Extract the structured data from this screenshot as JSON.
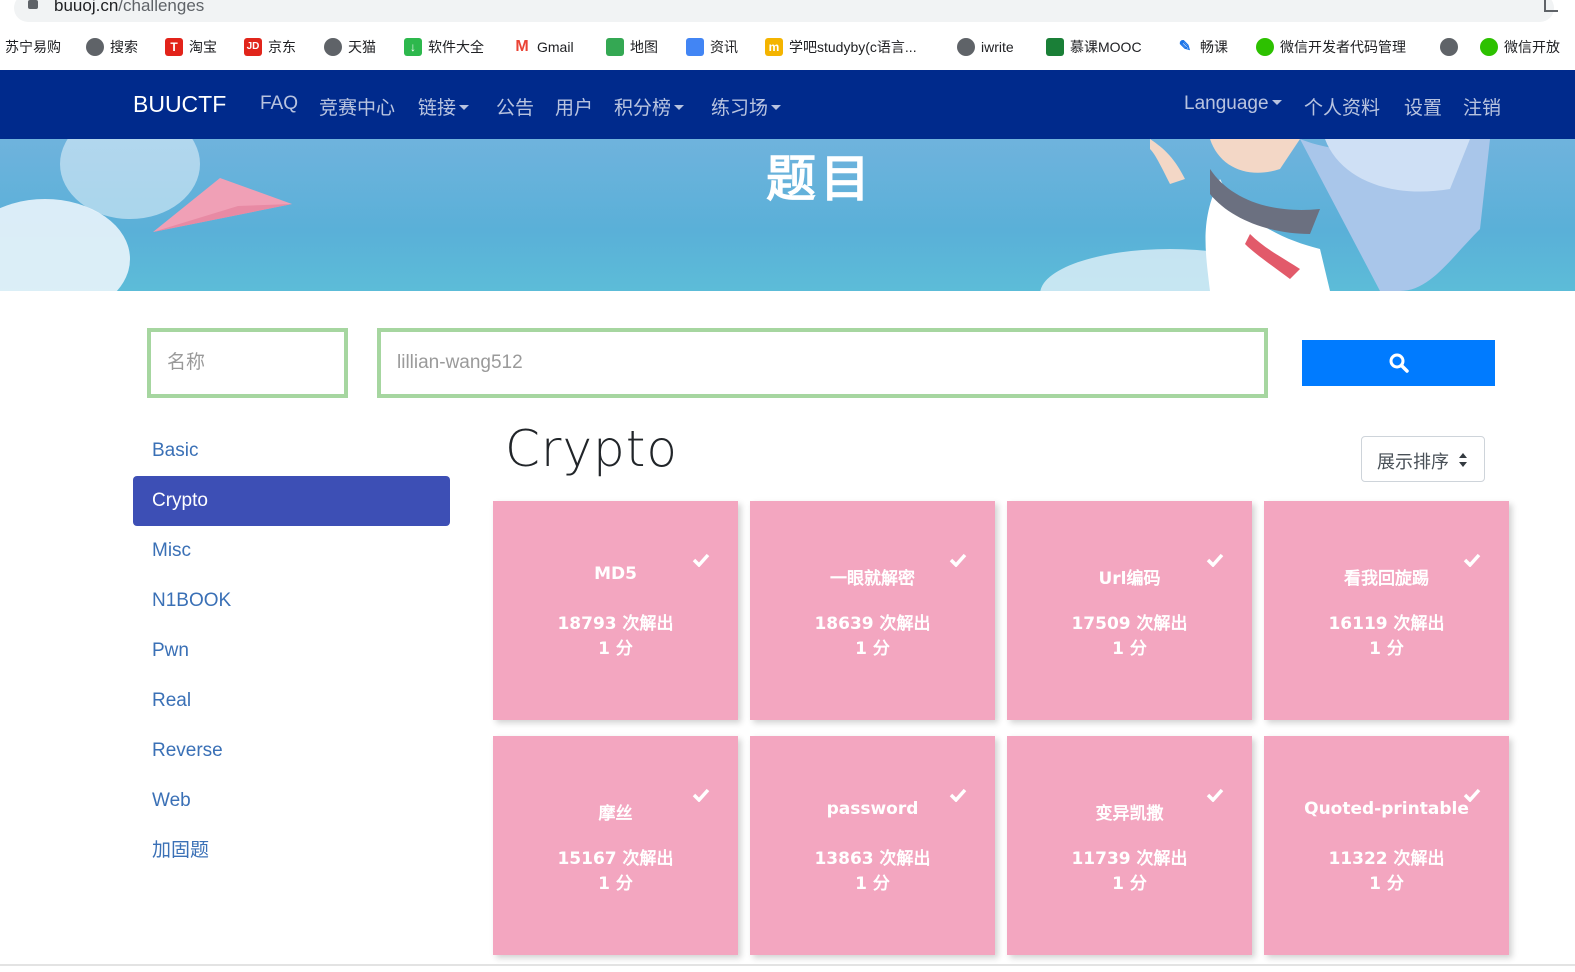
{
  "browser": {
    "url_host": "buuoj.cn",
    "url_path": "/challenges"
  },
  "bookmarks": [
    {
      "label": "苏宁易购",
      "icon": "none"
    },
    {
      "label": "搜索",
      "icon": "globe-icon"
    },
    {
      "label": "淘宝",
      "icon": "tmall-icon"
    },
    {
      "label": "京东",
      "icon": "jd-icon"
    },
    {
      "label": "天猫",
      "icon": "globe-icon"
    },
    {
      "label": "软件大全",
      "icon": "download-icon"
    },
    {
      "label": "Gmail",
      "icon": "gmail-icon"
    },
    {
      "label": "地图",
      "icon": "maps-icon"
    },
    {
      "label": "资讯",
      "icon": "news-icon"
    },
    {
      "label": "学吧studyby(c语言...",
      "icon": "xueba-icon"
    },
    {
      "label": "iwrite",
      "icon": "globe-icon"
    },
    {
      "label": "慕课MOOC",
      "icon": "mooc-icon"
    },
    {
      "label": "畅课",
      "icon": "changke-icon"
    },
    {
      "label": "微信开发者代码管理",
      "icon": "wechat-icon"
    },
    {
      "label": "",
      "icon": "globe-icon"
    },
    {
      "label": "微信开放",
      "icon": "wechat-icon"
    }
  ],
  "navbar": {
    "brand": "BUUCTF",
    "left_items": [
      "FAQ",
      "竞赛中心",
      "链接",
      "公告",
      "用户",
      "积分榜",
      "练习场"
    ],
    "right_items": [
      "Language",
      "个人资料",
      "设置",
      "注销"
    ],
    "bg": "#002a8c"
  },
  "banner": {
    "title": "题目"
  },
  "search": {
    "name_placeholder": "名称",
    "user_value": "lillian-wang512",
    "button_icon": "search-icon",
    "button_color": "#007bff"
  },
  "sidebar": {
    "items": [
      "Basic",
      "Crypto",
      "Misc",
      "N1BOOK",
      "Pwn",
      "Real",
      "Reverse",
      "Web",
      "加固题"
    ],
    "active": "Crypto"
  },
  "main": {
    "heading": "Crypto",
    "sort_label": "展示排序"
  },
  "challenges": [
    {
      "name": "MD5",
      "solves": "18793 次解出",
      "score": "1 分"
    },
    {
      "name": "一眼就解密",
      "solves": "18639 次解出",
      "score": "1 分"
    },
    {
      "name": "Url编码",
      "solves": "17509 次解出",
      "score": "1 分"
    },
    {
      "name": "看我回旋踢",
      "solves": "16119 次解出",
      "score": "1 分"
    },
    {
      "name": "摩丝",
      "solves": "15167 次解出",
      "score": "1 分"
    },
    {
      "name": "password",
      "solves": "13863 次解出",
      "score": "1 分"
    },
    {
      "name": "变异凯撒",
      "solves": "11739 次解出",
      "score": "1 分"
    },
    {
      "name": "Quoted-printable",
      "solves": "11322 次解出",
      "score": "1 分"
    }
  ],
  "colors": {
    "card": "#f3a6c0",
    "sidebar_active": "#3d4fb5",
    "input_border": "#a6d6a0"
  }
}
